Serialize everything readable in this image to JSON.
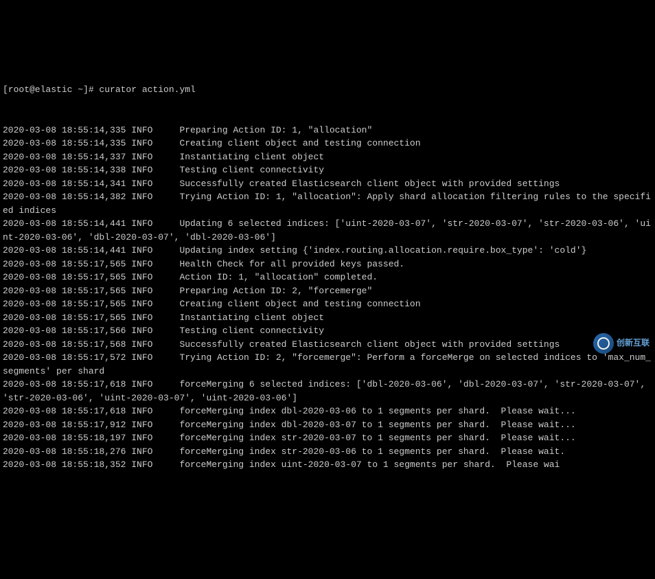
{
  "prompt": "[root@elastic ~]# curator action.yml",
  "logs": [
    {
      "ts": "2020-03-08 18:55:14,335",
      "lvl": "INFO",
      "msg": "Preparing Action ID: 1, \"allocation\""
    },
    {
      "ts": "2020-03-08 18:55:14,335",
      "lvl": "INFO",
      "msg": "Creating client object and testing connection"
    },
    {
      "ts": "2020-03-08 18:55:14,337",
      "lvl": "INFO",
      "msg": "Instantiating client object"
    },
    {
      "ts": "2020-03-08 18:55:14,338",
      "lvl": "INFO",
      "msg": "Testing client connectivity"
    },
    {
      "ts": "2020-03-08 18:55:14,341",
      "lvl": "INFO",
      "msg": "Successfully created Elasticsearch client object with provided settings"
    },
    {
      "ts": "2020-03-08 18:55:14,382",
      "lvl": "INFO",
      "msg": "Trying Action ID: 1, \"allocation\": Apply shard allocation filtering rules to the specified indices"
    },
    {
      "ts": "2020-03-08 18:55:14,441",
      "lvl": "INFO",
      "msg": "Updating 6 selected indices: ['uint-2020-03-07', 'str-2020-03-07', 'str-2020-03-06', 'uint-2020-03-06', 'dbl-2020-03-07', 'dbl-2020-03-06']"
    },
    {
      "ts": "2020-03-08 18:55:14,441",
      "lvl": "INFO",
      "msg": "Updating index setting {'index.routing.allocation.require.box_type': 'cold'}"
    },
    {
      "ts": "2020-03-08 18:55:17,565",
      "lvl": "INFO",
      "msg": "Health Check for all provided keys passed."
    },
    {
      "ts": "2020-03-08 18:55:17,565",
      "lvl": "INFO",
      "msg": "Action ID: 1, \"allocation\" completed."
    },
    {
      "ts": "2020-03-08 18:55:17,565",
      "lvl": "INFO",
      "msg": "Preparing Action ID: 2, \"forcemerge\""
    },
    {
      "ts": "2020-03-08 18:55:17,565",
      "lvl": "INFO",
      "msg": "Creating client object and testing connection"
    },
    {
      "ts": "2020-03-08 18:55:17,565",
      "lvl": "INFO",
      "msg": "Instantiating client object"
    },
    {
      "ts": "2020-03-08 18:55:17,566",
      "lvl": "INFO",
      "msg": "Testing client connectivity"
    },
    {
      "ts": "2020-03-08 18:55:17,568",
      "lvl": "INFO",
      "msg": "Successfully created Elasticsearch client object with provided settings"
    },
    {
      "ts": "2020-03-08 18:55:17,572",
      "lvl": "INFO",
      "msg": "Trying Action ID: 2, \"forcemerge\": Perform a forceMerge on selected indices to 'max_num_segments' per shard"
    },
    {
      "ts": "2020-03-08 18:55:17,618",
      "lvl": "INFO",
      "msg": "forceMerging 6 selected indices: ['dbl-2020-03-06', 'dbl-2020-03-07', 'str-2020-03-07', 'str-2020-03-06', 'uint-2020-03-07', 'uint-2020-03-06']"
    },
    {
      "ts": "2020-03-08 18:55:17,618",
      "lvl": "INFO",
      "msg": "forceMerging index dbl-2020-03-06 to 1 segments per shard.  Please wait..."
    },
    {
      "ts": "2020-03-08 18:55:17,912",
      "lvl": "INFO",
      "msg": "forceMerging index dbl-2020-03-07 to 1 segments per shard.  Please wait..."
    },
    {
      "ts": "2020-03-08 18:55:18,197",
      "lvl": "INFO",
      "msg": "forceMerging index str-2020-03-07 to 1 segments per shard.  Please wait..."
    },
    {
      "ts": "2020-03-08 18:55:18,276",
      "lvl": "INFO",
      "msg": "forceMerging index str-2020-03-06 to 1 segments per shard.  Please wait."
    },
    {
      "ts": "2020-03-08 18:55:18,352",
      "lvl": "INFO",
      "msg": "forceMerging index uint-2020-03-07 to 1 segments per shard.  Please wai"
    }
  ],
  "watermark": {
    "text": "创新互联"
  }
}
